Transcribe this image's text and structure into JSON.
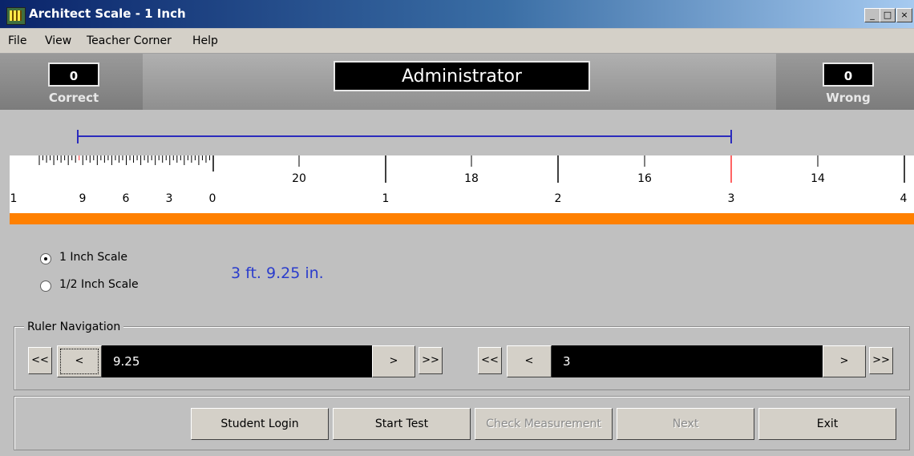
{
  "window": {
    "title": "Architect Scale - 1 Inch",
    "min_btn": "_",
    "max_btn": "□",
    "close_btn": "×"
  },
  "menu": [
    "File",
    "View",
    "Teacher Corner",
    "Help"
  ],
  "score": {
    "correct_value": "0",
    "correct_label": "Correct",
    "user_name": "Administrator",
    "wrong_value": "0",
    "wrong_label": "Wrong"
  },
  "ruler": {
    "top_labels": [
      "20",
      "18",
      "16",
      "14"
    ],
    "bottom_labels": [
      "1",
      "9",
      "6",
      "3",
      "0",
      "1",
      "2",
      "3",
      "4"
    ],
    "measure_line_color": "#2b2bbd",
    "marker_color": "#ff4040",
    "band_color": "#ff8000"
  },
  "scale_options": [
    {
      "label": "1  Inch Scale",
      "checked": true
    },
    {
      "label": "1/2  Inch Scale",
      "checked": false
    }
  ],
  "measurement": "3 ft. 9.25 in.",
  "navigation": {
    "legend": "Ruler Navigation",
    "first": "<<",
    "prev": "<",
    "next": ">",
    "last": ">>",
    "left_value": "9.25",
    "right_value": "3"
  },
  "buttons": {
    "student_login": "Student Login",
    "start_test": "Start Test",
    "check_measurement": "Check Measurement",
    "next": "Next",
    "exit": "Exit"
  }
}
